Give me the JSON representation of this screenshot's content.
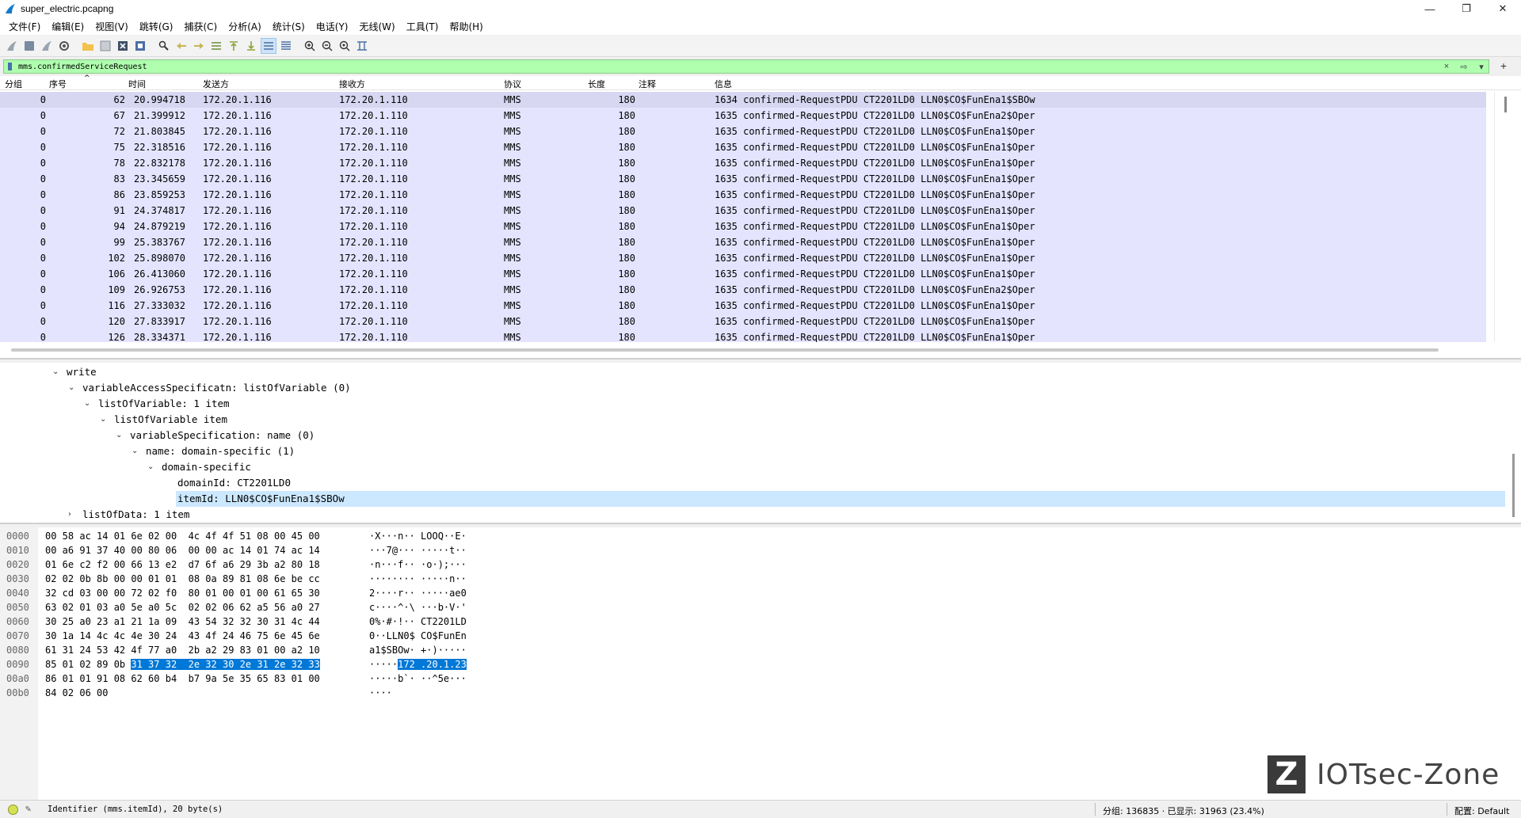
{
  "window": {
    "title": "super_electric.pcapng",
    "minimize": "—",
    "restore": "❐",
    "close": "✕"
  },
  "menu": [
    "文件(F)",
    "编辑(E)",
    "视图(V)",
    "跳转(G)",
    "捕获(C)",
    "分析(A)",
    "统计(S)",
    "电话(Y)",
    "无线(W)",
    "工具(T)",
    "帮助(H)"
  ],
  "filter": {
    "value": "mms.confirmedServiceRequest",
    "clear_icon": "×",
    "apply_icon": "⇨",
    "dropdown_icon": "▾",
    "add_icon": "+"
  },
  "packet_list": {
    "columns": [
      "分组",
      "序号",
      "时间",
      "发送方",
      "接收方",
      "协议",
      "长度",
      "注释",
      "信息"
    ],
    "rows": [
      {
        "grp": "0",
        "no": "62",
        "time": "20.994718",
        "src": "172.20.1.116",
        "dst": "172.20.1.110",
        "proto": "MMS",
        "len": "180",
        "info": "1634 confirmed-RequestPDU CT2201LD0 LLN0$CO$FunEna1$SBOw"
      },
      {
        "grp": "0",
        "no": "67",
        "time": "21.399912",
        "src": "172.20.1.116",
        "dst": "172.20.1.110",
        "proto": "MMS",
        "len": "180",
        "info": "1635 confirmed-RequestPDU CT2201LD0 LLN0$CO$FunEna2$Oper"
      },
      {
        "grp": "0",
        "no": "72",
        "time": "21.803845",
        "src": "172.20.1.116",
        "dst": "172.20.1.110",
        "proto": "MMS",
        "len": "180",
        "info": "1635 confirmed-RequestPDU CT2201LD0 LLN0$CO$FunEna1$Oper"
      },
      {
        "grp": "0",
        "no": "75",
        "time": "22.318516",
        "src": "172.20.1.116",
        "dst": "172.20.1.110",
        "proto": "MMS",
        "len": "180",
        "info": "1635 confirmed-RequestPDU CT2201LD0 LLN0$CO$FunEna1$Oper"
      },
      {
        "grp": "0",
        "no": "78",
        "time": "22.832178",
        "src": "172.20.1.116",
        "dst": "172.20.1.110",
        "proto": "MMS",
        "len": "180",
        "info": "1635 confirmed-RequestPDU CT2201LD0 LLN0$CO$FunEna1$Oper"
      },
      {
        "grp": "0",
        "no": "83",
        "time": "23.345659",
        "src": "172.20.1.116",
        "dst": "172.20.1.110",
        "proto": "MMS",
        "len": "180",
        "info": "1635 confirmed-RequestPDU CT2201LD0 LLN0$CO$FunEna1$Oper"
      },
      {
        "grp": "0",
        "no": "86",
        "time": "23.859253",
        "src": "172.20.1.116",
        "dst": "172.20.1.110",
        "proto": "MMS",
        "len": "180",
        "info": "1635 confirmed-RequestPDU CT2201LD0 LLN0$CO$FunEna1$Oper"
      },
      {
        "grp": "0",
        "no": "91",
        "time": "24.374817",
        "src": "172.20.1.116",
        "dst": "172.20.1.110",
        "proto": "MMS",
        "len": "180",
        "info": "1635 confirmed-RequestPDU CT2201LD0 LLN0$CO$FunEna1$Oper"
      },
      {
        "grp": "0",
        "no": "94",
        "time": "24.879219",
        "src": "172.20.1.116",
        "dst": "172.20.1.110",
        "proto": "MMS",
        "len": "180",
        "info": "1635 confirmed-RequestPDU CT2201LD0 LLN0$CO$FunEna1$Oper"
      },
      {
        "grp": "0",
        "no": "99",
        "time": "25.383767",
        "src": "172.20.1.116",
        "dst": "172.20.1.110",
        "proto": "MMS",
        "len": "180",
        "info": "1635 confirmed-RequestPDU CT2201LD0 LLN0$CO$FunEna1$Oper"
      },
      {
        "grp": "0",
        "no": "102",
        "time": "25.898070",
        "src": "172.20.1.116",
        "dst": "172.20.1.110",
        "proto": "MMS",
        "len": "180",
        "info": "1635 confirmed-RequestPDU CT2201LD0 LLN0$CO$FunEna1$Oper"
      },
      {
        "grp": "0",
        "no": "106",
        "time": "26.413060",
        "src": "172.20.1.116",
        "dst": "172.20.1.110",
        "proto": "MMS",
        "len": "180",
        "info": "1635 confirmed-RequestPDU CT2201LD0 LLN0$CO$FunEna1$Oper"
      },
      {
        "grp": "0",
        "no": "109",
        "time": "26.926753",
        "src": "172.20.1.116",
        "dst": "172.20.1.110",
        "proto": "MMS",
        "len": "180",
        "info": "1635 confirmed-RequestPDU CT2201LD0 LLN0$CO$FunEna2$Oper"
      },
      {
        "grp": "0",
        "no": "116",
        "time": "27.333032",
        "src": "172.20.1.116",
        "dst": "172.20.1.110",
        "proto": "MMS",
        "len": "180",
        "info": "1635 confirmed-RequestPDU CT2201LD0 LLN0$CO$FunEna1$Oper"
      },
      {
        "grp": "0",
        "no": "120",
        "time": "27.833917",
        "src": "172.20.1.116",
        "dst": "172.20.1.110",
        "proto": "MMS",
        "len": "180",
        "info": "1635 confirmed-RequestPDU CT2201LD0 LLN0$CO$FunEna1$Oper"
      },
      {
        "grp": "0",
        "no": "126",
        "time": "28.334371",
        "src": "172.20.1.116",
        "dst": "172.20.1.110",
        "proto": "MMS",
        "len": "180",
        "info": "1635 confirmed-RequestPDU CT2201LD0 LLN0$CO$FunEna1$Oper"
      }
    ]
  },
  "details": {
    "lines": [
      {
        "text": "write",
        "depth": 0,
        "state": "expanded"
      },
      {
        "text": "variableAccessSpecificatn: listOfVariable (0)",
        "depth": 1,
        "state": "expanded"
      },
      {
        "text": "listOfVariable: 1 item",
        "depth": 2,
        "state": "expanded"
      },
      {
        "text": "listOfVariable item",
        "depth": 3,
        "state": "expanded"
      },
      {
        "text": "variableSpecification: name (0)",
        "depth": 4,
        "state": "expanded"
      },
      {
        "text": "name: domain-specific (1)",
        "depth": 5,
        "state": "expanded"
      },
      {
        "text": "domain-specific",
        "depth": 6,
        "state": "expanded"
      },
      {
        "text": "domainId: CT2201LD0",
        "depth": 7,
        "state": "leaf"
      },
      {
        "text": "itemId: LLN0$CO$FunEna1$SBOw",
        "depth": 7,
        "state": "leaf",
        "selected": true
      },
      {
        "text": "listOfData: 1 item",
        "depth": 1,
        "state": "collapsed"
      }
    ]
  },
  "bytes": {
    "rows": [
      {
        "off": "0000",
        "hex": "00 58 ac 14 01 6e 02 00  4c 4f 4f 51 08 00 45 00",
        "ascii": "·X···n·· LOOQ··E·"
      },
      {
        "off": "0010",
        "hex": "00 a6 91 37 40 00 80 06  00 00 ac 14 01 74 ac 14",
        "ascii": "···7@··· ·····t··"
      },
      {
        "off": "0020",
        "hex": "01 6e c2 f2 00 66 13 e2  d7 6f a6 29 3b a2 80 18",
        "ascii": "·n···f·· ·o·);···"
      },
      {
        "off": "0030",
        "hex": "02 02 0b 8b 00 00 01 01  08 0a 89 81 08 6e be cc",
        "ascii": "········ ·····n··"
      },
      {
        "off": "0040",
        "hex": "32 cd 03 00 00 72 02 f0  80 01 00 01 00 61 65 30",
        "ascii": "2····r·· ·····ae0"
      },
      {
        "off": "0050",
        "hex": "63 02 01 03 a0 5e a0 5c  02 02 06 62 a5 56 a0 27",
        "ascii": "c····^·\\ ···b·V·'"
      },
      {
        "off": "0060",
        "hex": "30 25 a0 23 a1 21 1a 09  43 54 32 32 30 31 4c 44",
        "ascii": "0%·#·!·· CT2201LD"
      },
      {
        "off": "0070",
        "hex": "30 1a 14 4c 4c 4e 30 24  43 4f 24 46 75 6e 45 6e",
        "ascii": "0··LLN0$ CO$FunEn"
      },
      {
        "off": "0080",
        "hex": "61 31 24 53 42 4f 77 a0  2b a2 29 83 01 00 a2 10",
        "ascii": "a1$SBOw· +·)·····"
      },
      {
        "off": "0090",
        "hex_pre": "85 01 02 89 0b ",
        "hex_hl": "31 37 32  2e 32 30 2e 31 2e 32 33",
        "ascii_pre": "·····",
        "ascii_hl": "172 .20.1.23"
      },
      {
        "off": "00a0",
        "hex": "86 01 01 91 08 62 60 b4  b7 9a 5e 35 65 83 01 00",
        "ascii": "·····b`· ··^5e···"
      },
      {
        "off": "00b0",
        "hex": "84 02 06 00",
        "ascii": "····"
      }
    ]
  },
  "logo": {
    "letter": "Z",
    "text": "IOTsec-Zone"
  },
  "status": {
    "field": "Identifier (mms.itemId), 20 byte(s)",
    "packets": "分组: 136835 · 已显示: 31963 (23.4%)",
    "profile": "配置: Default"
  }
}
